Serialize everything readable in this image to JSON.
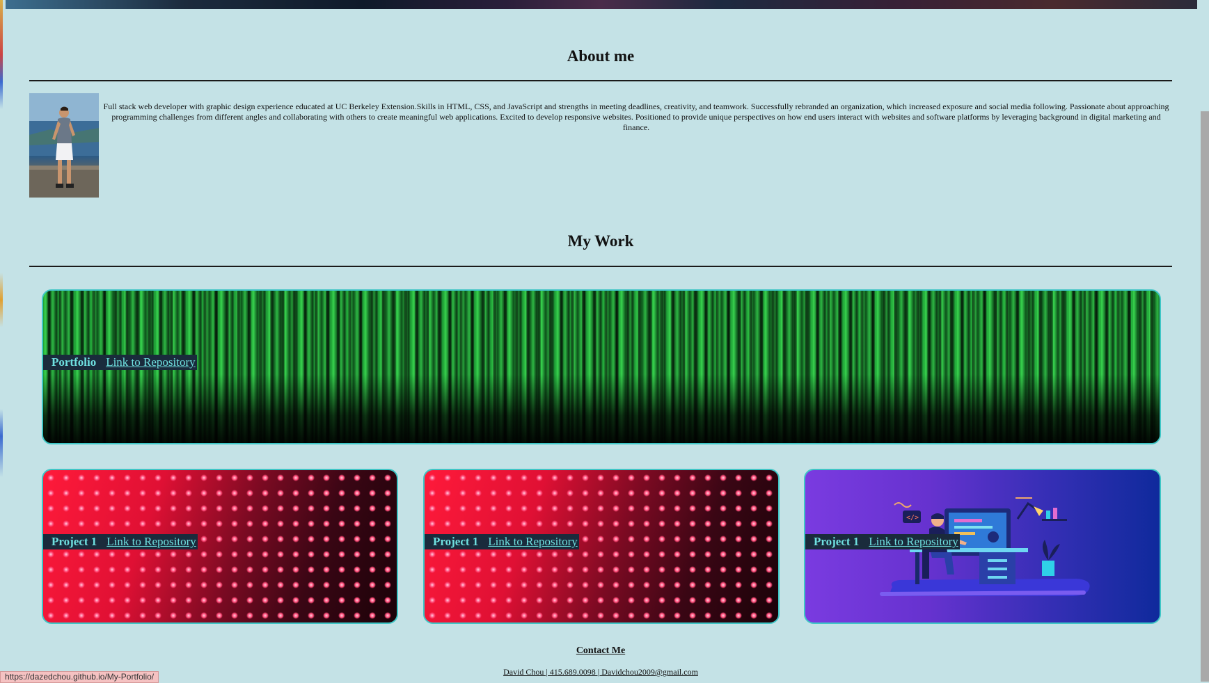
{
  "about": {
    "title": "About me",
    "text": "Full stack web developer with graphic design experience educated at UC Berkeley Extension.Skills in HTML, CSS, and JavaScript and strengths in meeting deadlines, creativity, and teamwork. Successfully rebranded an organization, which increased exposure and social media following. Passionate about approaching programming challenges from different angles and collaborating with others to create meaningful web applications. Excited to develop responsive websites. Positioned to provide unique perspectives on how end users interact with websites and software platforms by leveraging background in digital marketing and finance."
  },
  "work": {
    "title": "My Work",
    "featured": {
      "title": "Portfolio",
      "link": "Link to Repository"
    },
    "projects": [
      {
        "title": "Project 1",
        "link": "Link to Repository"
      },
      {
        "title": "Project 1",
        "link": "Link to Repository"
      },
      {
        "title": "Project 1",
        "link": "Link to Repository"
      }
    ]
  },
  "contact": {
    "title": "Contact Me",
    "line": "David Chou | 415.689.0098 | Davidchou2009@gmail.com"
  },
  "status_bar": {
    "url": "https://dazedchou.github.io/My-Portfolio/"
  },
  "icons": {
    "desk_icon": "code-bracket-icon"
  }
}
